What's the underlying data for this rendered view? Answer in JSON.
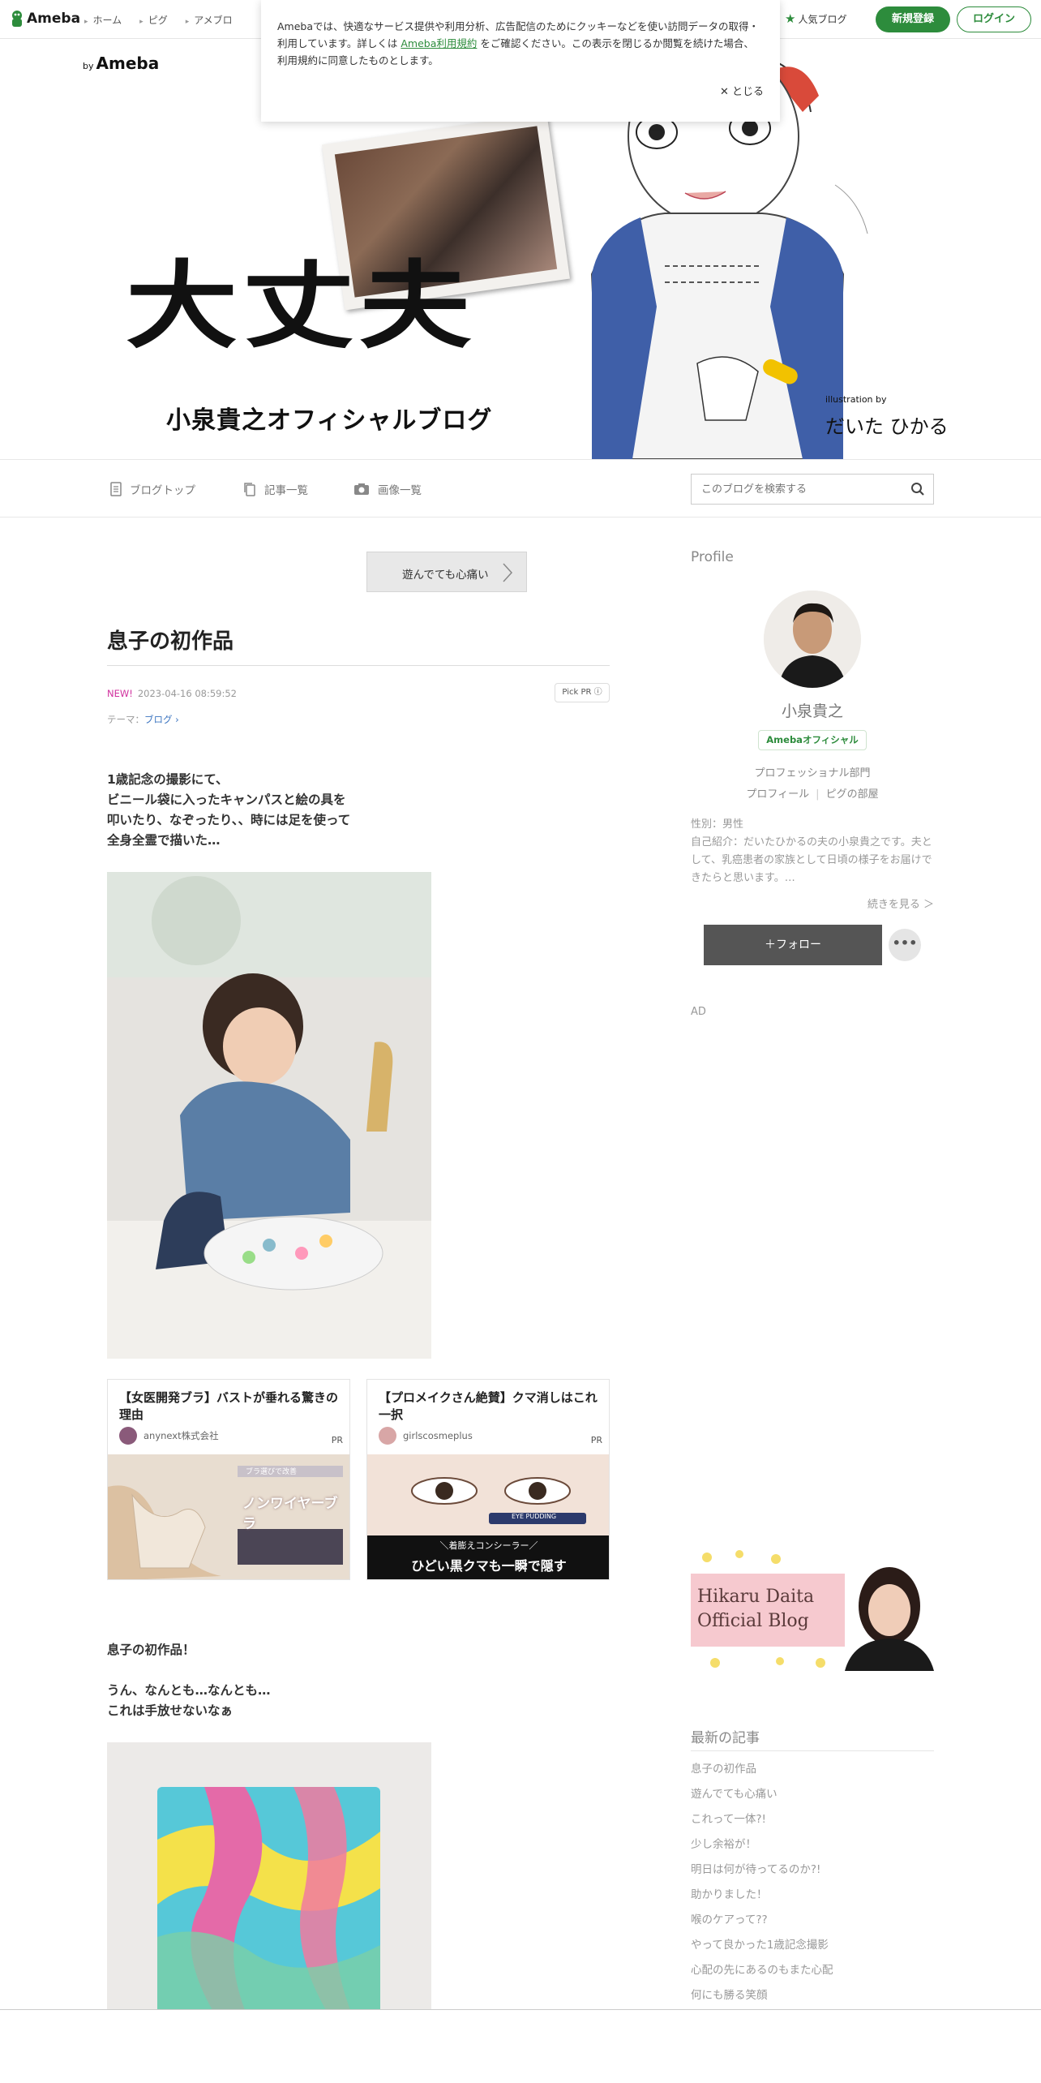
{
  "global_nav": {
    "logo": "Ameba",
    "links": [
      "ホーム",
      "ピグ",
      "アメブロ"
    ],
    "popular": "人気ブログ",
    "signup": "新規登録",
    "login": "ログイン"
  },
  "cookie": {
    "text_before": "Amebaでは、快適なサービス提供や利用分析、広告配信のためにクッキーなどを使い訪問データの取得・利用しています。詳しくは",
    "link": "Ameba利用規約",
    "text_after": "をご確認ください。この表示を閉じるか閲覧を続けた場合、利用規約に同意したものとします。",
    "close": "✕ とじる"
  },
  "header": {
    "by": "by",
    "brand": "Ameba",
    "title": "大丈夫",
    "subtitle": "小泉貴之オフィシャルブログ",
    "credit": "illustration by",
    "illustrator": "だいた ひかる"
  },
  "blog_nav": {
    "top": "ブログトップ",
    "entries": "記事一覧",
    "images": "画像一覧",
    "search_placeholder": "このブログを検索する"
  },
  "entry": {
    "prev_title": "遊んでても心痛い",
    "title": "息子の初作品",
    "new_badge": "NEW!",
    "date": "2023-04-16 08:59:52",
    "pick_pr": "Pick PR ⓘ",
    "theme_label": "テーマ：",
    "theme": "ブログ",
    "para1": [
      "1歳記念の撮影にて、",
      "ビニール袋に入ったキャンパスと絵の具を",
      "叩いたり、なぞったり、、時には足を使って",
      "全身全霊で描いた…"
    ],
    "para2": [
      "息子の初作品！"
    ],
    "para3": [
      "うん、なんとも…なんとも…",
      "これは手放せないなぁ"
    ]
  },
  "ads": [
    {
      "title": "【女医開発ブラ】バストが垂れる驚きの理由",
      "advertiser": "anynext株式会社",
      "pr": "PR",
      "img_top": "ブラ選びで改善",
      "img_main": "ノンワイヤーブラ"
    },
    {
      "title": "【プロメイクさん絶賛】クマ消しはこれ一択",
      "advertiser": "girlscosmeplus",
      "pr": "PR",
      "img_product": "EYE PUDDING",
      "img_line1": "＼着膨えコンシーラー／",
      "img_line2": "ひどい黒クマも一瞬で隠す"
    }
  ],
  "sidebar": {
    "profile_heading": "Profile",
    "name": "小泉貴之",
    "official": "Amebaオフィシャル",
    "category": "プロフェッショナル部門",
    "link_profile": "プロフィール",
    "link_pig": "ピグの部屋",
    "gender": "性別：男性",
    "intro": "自己紹介：だいたひかるの夫の小泉貴之です。夫として、乳癌患者の家族として日頃の様子をお届けできたらと思います。…",
    "more": "続きを見る ＞",
    "follow": "＋フォロー",
    "dots": "•••",
    "ad_label": "AD",
    "banner_line1": "Hikaru Daita",
    "banner_line2": "Official Blog",
    "recent_heading": "最新の記事",
    "recent": [
      "息子の初作品",
      "遊んでても心痛い",
      "これって一体?!",
      "少し余裕が！",
      "明日は何が待ってるのか?!",
      "助かりました！",
      "喉のケアって??",
      "やって良かった1歳記念撮影",
      "心配の先にあるのもまた心配",
      "何にも勝る笑顔"
    ]
  }
}
